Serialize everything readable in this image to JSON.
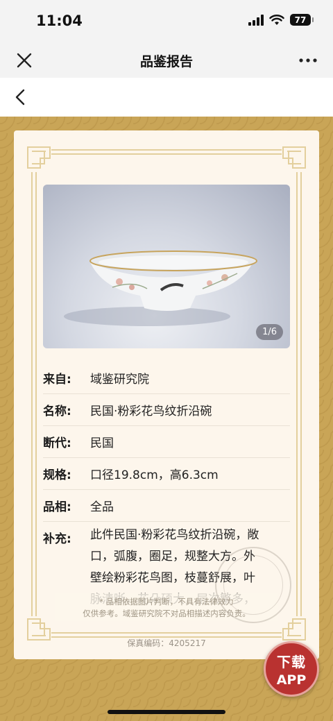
{
  "status_bar": {
    "time": "11:04",
    "battery": "77"
  },
  "nav": {
    "title": "品鉴报告"
  },
  "photo": {
    "page_indicator": "1/6"
  },
  "details": [
    {
      "key": "来自:",
      "value": "域鉴研究院"
    },
    {
      "key": "名称:",
      "value": "民国·粉彩花鸟纹折沿碗"
    },
    {
      "key": "断代:",
      "value": "民国"
    },
    {
      "key": "规格:",
      "value": "口径19.8cm，高6.3cm"
    },
    {
      "key": "品相:",
      "value": "全品"
    }
  ],
  "supplement": {
    "key": "补充:",
    "lines": [
      "此件民国·粉彩花鸟纹折沿碗，敞",
      "口，弧腹，圈足，规整大方。外",
      "壁绘粉彩花鸟图，枝蔓舒展，叶",
      "脉清晰，花朵硕大，层次繁多，"
    ]
  },
  "disclaimer": {
    "line1": "* 品相依据图片判断，不具有法律效力",
    "line2": "仅供参考。域鉴研究院不对品相描述内容负责。"
  },
  "serial": {
    "label": "保真编码：",
    "value": "4205217"
  },
  "download": {
    "line1": "下载",
    "line2": "APP"
  },
  "colors": {
    "background_gold": "#c9a557",
    "card": "#fdf6ec",
    "download_red": "#b93230"
  }
}
